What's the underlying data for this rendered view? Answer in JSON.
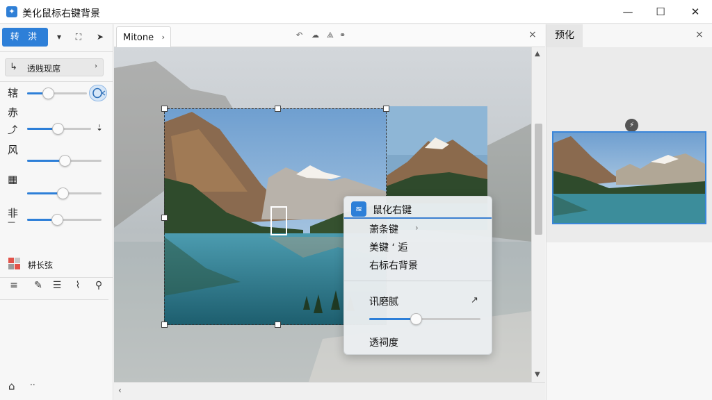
{
  "window": {
    "title": "美化鼠标右键背景",
    "minimize": "—",
    "maximize": "☐",
    "close": "✕"
  },
  "toolbar": {
    "active_segment": "转 洪",
    "icons": [
      "▾",
      "⛶",
      "➤"
    ]
  },
  "left_panel": {
    "dropdown_label": "透贱现席",
    "sliders": [
      {
        "label": "辖",
        "value": 0.35
      },
      {
        "label": "赤",
        "value": 0.48
      },
      {
        "label": "风",
        "value": 0.5
      },
      {
        "label": "",
        "value": 0.48
      },
      {
        "label": "非",
        "value": 0.4
      }
    ],
    "side_glyphs": [
      "辖",
      "赤",
      "风",
      "非"
    ],
    "swatch_label": "耕长弦"
  },
  "document": {
    "tab_label": "Mitone",
    "tab_chevron": "›",
    "close": "×"
  },
  "context_menu": {
    "header": "鼠化右键",
    "items": [
      {
        "label": "萧条键",
        "submenu": true
      },
      {
        "label": "美键 ‘ 逅",
        "submenu": false
      },
      {
        "label": "右标右背景",
        "submenu": false
      }
    ],
    "section_label": "讯磨腻",
    "opacity_label": "透祠度",
    "opacity_value": 0.42
  },
  "preview": {
    "tab_label": "预化",
    "close": "×"
  },
  "colors": {
    "accent": "#2d7fd8",
    "menu_border": "#3a7fd0"
  }
}
